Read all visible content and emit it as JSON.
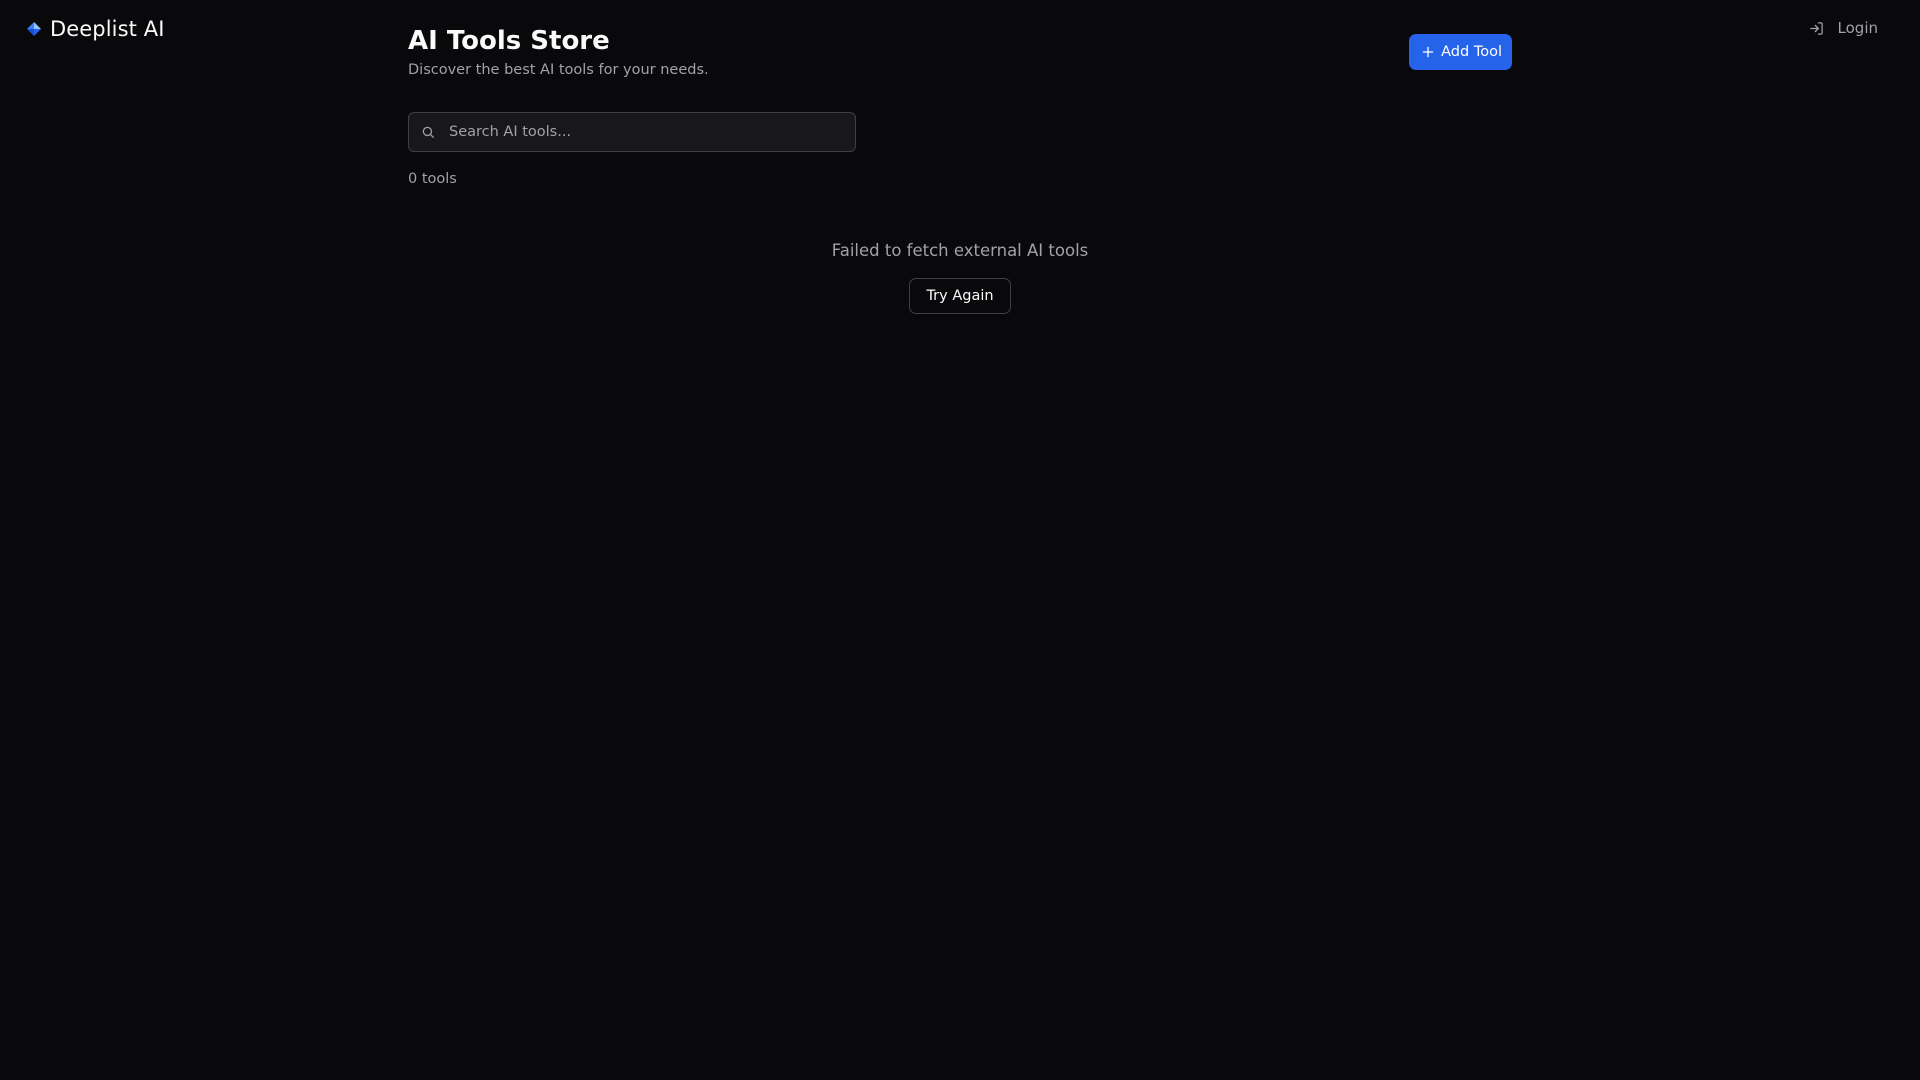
{
  "brand": {
    "name": "Deeplist AI",
    "logo_icon": "diamond-logo-icon",
    "logo_colors": [
      "#60a5fa",
      "#2563eb",
      "#1d4ed8",
      "#93c5fd"
    ]
  },
  "nav": {
    "login_label": "Login",
    "login_icon": "login-icon"
  },
  "header": {
    "title": "AI Tools Store",
    "subtitle": "Discover the best AI tools for your needs.",
    "add_tool_label": "Add Tool",
    "add_tool_icon": "plus-icon"
  },
  "search": {
    "placeholder": "Search AI tools...",
    "value": "",
    "icon": "search-icon"
  },
  "results": {
    "count_label": "0 tools"
  },
  "error": {
    "message": "Failed to fetch external AI tools",
    "retry_label": "Try Again"
  },
  "colors": {
    "background": "#09090b",
    "accent": "#2563eb",
    "muted_text": "#a1a1aa",
    "border": "#3f3f46"
  }
}
